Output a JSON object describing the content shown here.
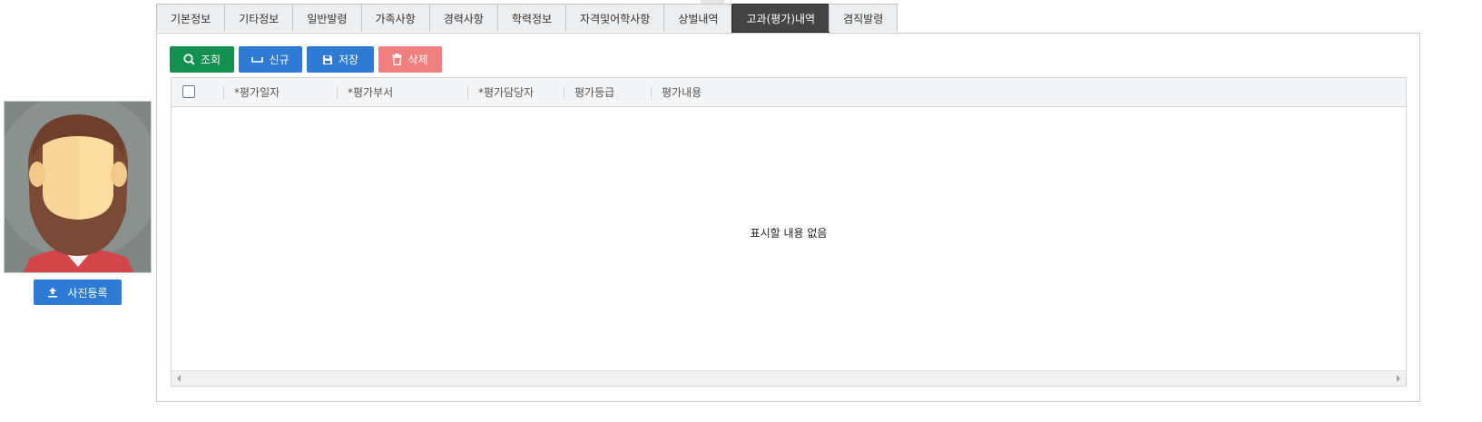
{
  "tabs": [
    {
      "label": "기본정보",
      "active": false
    },
    {
      "label": "기타정보",
      "active": false
    },
    {
      "label": "일반발령",
      "active": false
    },
    {
      "label": "가족사항",
      "active": false
    },
    {
      "label": "경력사항",
      "active": false
    },
    {
      "label": "학력정보",
      "active": false
    },
    {
      "label": "자격및어학사항",
      "active": false
    },
    {
      "label": "상벌내역",
      "active": false
    },
    {
      "label": "고과(평가)내역",
      "active": true
    },
    {
      "label": "겸직발령",
      "active": false
    }
  ],
  "photo": {
    "upload_label": "사진등록",
    "upload_icon": "upload-icon"
  },
  "toolbar": {
    "search_label": "조회",
    "new_label": "신규",
    "save_label": "저장",
    "delete_label": "삭제",
    "colors": {
      "search": "#13904f",
      "new": "#2e7bd6",
      "save": "#2e7bd6",
      "delete": "#f07f80"
    }
  },
  "grid": {
    "columns": [
      "*평가일자",
      "*평가부서",
      "*평가담당자",
      "평가등급",
      "평가내용"
    ],
    "empty_message": "표시할 내용 없음"
  },
  "accent_active_tab": "#444444"
}
